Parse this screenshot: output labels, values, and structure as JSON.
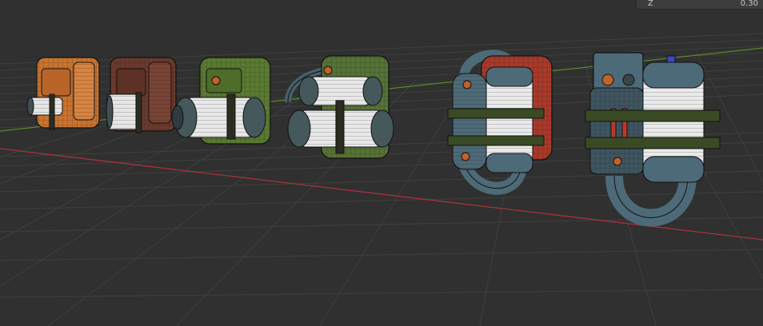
{
  "viewport": {
    "background": "#303030",
    "grid_color": "#3f3f3f",
    "x_axis_color": "#a8323f",
    "y_axis_color": "#5c8a2a",
    "objects": [
      {
        "name": "backpack-orange",
        "color": "#c9742f"
      },
      {
        "name": "backpack-brown",
        "color": "#6a3a2c"
      },
      {
        "name": "backpack-green-tank",
        "color": "#5a7a32"
      },
      {
        "name": "backpack-green-double-tank",
        "color": "#567236"
      },
      {
        "name": "jetpack-red",
        "color": "#a83a2a"
      },
      {
        "name": "jetpack-teal",
        "color": "#4d6a78"
      }
    ]
  },
  "properties_panel": {
    "axis_label": "Z",
    "value": "0.30"
  }
}
